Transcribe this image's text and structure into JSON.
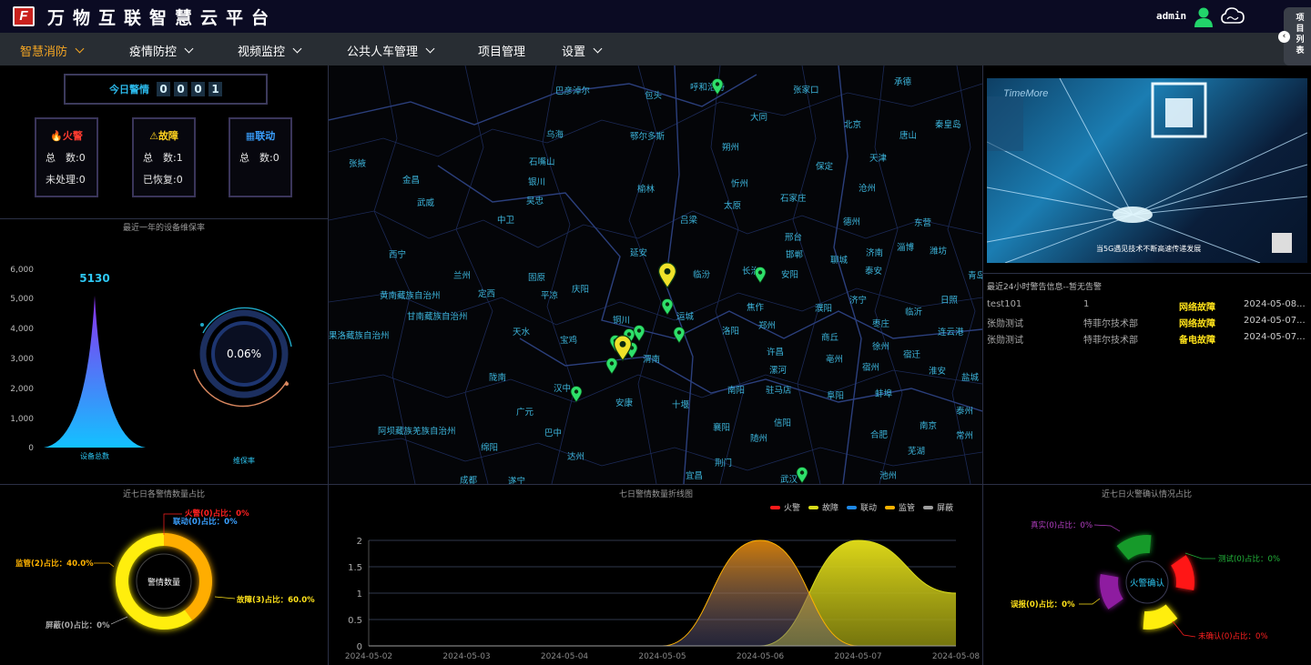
{
  "header": {
    "title": "万物互联智慧云平台",
    "logo_text": "F",
    "user": "admin",
    "user_icon": "person-icon",
    "cloud_icon": "cloud-icon"
  },
  "nav": {
    "items": [
      {
        "label": "智慧消防",
        "has_dropdown": true,
        "active": true
      },
      {
        "label": "疫情防控",
        "has_dropdown": true
      },
      {
        "label": "视频监控",
        "has_dropdown": true
      },
      {
        "label": "公共人车管理",
        "has_dropdown": true
      },
      {
        "label": "项目管理",
        "has_dropdown": false
      },
      {
        "label": "设置",
        "has_dropdown": true
      }
    ],
    "side_tab": "项目列表",
    "accent": "#f5a623"
  },
  "today": {
    "label": "今日警情",
    "digits": [
      "0",
      "0",
      "0",
      "1"
    ]
  },
  "cards": [
    {
      "title": "火警",
      "icon": "flame-icon",
      "color": "#ff3b30",
      "lines": [
        "总　数:0",
        "未处理:0"
      ]
    },
    {
      "title": "故障",
      "icon": "warning-icon",
      "color": "#ffd21f",
      "lines": [
        "总　数:1",
        "已恢复:0"
      ]
    },
    {
      "title": "联动",
      "icon": "link-panel-icon",
      "color": "#3aa0ff",
      "lines": [
        "总　数:0"
      ]
    }
  ],
  "maintenance": {
    "title": "最近一年的设备维保率",
    "peak_label": "5130",
    "y_ticks": [
      "6,000",
      "5,000",
      "4,000",
      "3,000",
      "2,000",
      "1,000",
      "0"
    ],
    "x_label": "设备总数",
    "gauge_value": "0.06%",
    "gauge_label": "维保率"
  },
  "map": {
    "cities": [
      [
        "巴彦淖尔",
        610,
        98
      ],
      [
        "包头",
        708,
        103
      ],
      [
        "呼和浩特",
        758,
        94
      ],
      [
        "张家口",
        871,
        97
      ],
      [
        "承德",
        982,
        88
      ],
      [
        "大同",
        824,
        127
      ],
      [
        "北京",
        927,
        135
      ],
      [
        "秦皇岛",
        1027,
        135
      ],
      [
        "乌海",
        600,
        146
      ],
      [
        "鄂尔多斯",
        692,
        148
      ],
      [
        "朔州",
        793,
        160
      ],
      [
        "唐山",
        988,
        147
      ],
      [
        "天津",
        955,
        172
      ],
      [
        "张掖",
        383,
        178
      ],
      [
        "石嘴山",
        581,
        176
      ],
      [
        "保定",
        896,
        181
      ],
      [
        "金昌",
        442,
        196
      ],
      [
        "银川",
        580,
        198
      ],
      [
        "忻州",
        803,
        200
      ],
      [
        "榆林",
        700,
        206
      ],
      [
        "沧州",
        943,
        205
      ],
      [
        "武威",
        458,
        221
      ],
      [
        "吴忠",
        578,
        219
      ],
      [
        "太原",
        795,
        224
      ],
      [
        "石家庄",
        857,
        216
      ],
      [
        "中卫",
        546,
        240
      ],
      [
        "吕梁",
        747,
        240
      ],
      [
        "德州",
        926,
        242
      ],
      [
        "东营",
        1004,
        243
      ],
      [
        "邢台",
        862,
        259
      ],
      [
        "西宁",
        427,
        278
      ],
      [
        "延安",
        692,
        276
      ],
      [
        "邯郸",
        863,
        278
      ],
      [
        "济南",
        951,
        276
      ],
      [
        "淄博",
        985,
        270
      ],
      [
        "潍坊",
        1021,
        274
      ],
      [
        "兰州",
        498,
        301
      ],
      [
        "固原",
        580,
        303
      ],
      [
        "临汾",
        761,
        300
      ],
      [
        "长治",
        815,
        296
      ],
      [
        "安阳",
        858,
        300
      ],
      [
        "聊城",
        912,
        284
      ],
      [
        "泰安",
        950,
        296
      ],
      [
        "青岛",
        1063,
        301
      ],
      [
        "黄南藏族自治州",
        417,
        323
      ],
      [
        "定西",
        525,
        321
      ],
      [
        "庆阳",
        628,
        316
      ],
      [
        "平凉",
        594,
        323
      ],
      [
        "焦作",
        820,
        336
      ],
      [
        "濮阳",
        895,
        337
      ],
      [
        "济宁",
        933,
        328
      ],
      [
        "日照",
        1033,
        328
      ],
      [
        "甘南藏族自治州",
        447,
        346
      ],
      [
        "铜川",
        673,
        350
      ],
      [
        "运城",
        743,
        346
      ],
      [
        "郑州",
        833,
        356
      ],
      [
        "枣庄",
        958,
        354
      ],
      [
        "临沂",
        994,
        341
      ],
      [
        "果洛藏族自治州",
        361,
        367
      ],
      [
        "天水",
        563,
        363
      ],
      [
        "宝鸡",
        615,
        372
      ],
      [
        "洛阳",
        793,
        362
      ],
      [
        "商丘",
        902,
        369
      ],
      [
        "徐州",
        958,
        379
      ],
      [
        "连云港",
        1030,
        363
      ],
      [
        "渭南",
        706,
        393
      ],
      [
        "许昌",
        842,
        385
      ],
      [
        "亳州",
        907,
        393
      ],
      [
        "宿迁",
        992,
        388
      ],
      [
        "陇南",
        537,
        413
      ],
      [
        "汉中",
        608,
        425
      ],
      [
        "漯河",
        845,
        405
      ],
      [
        "宿州",
        947,
        402
      ],
      [
        "淮安",
        1020,
        406
      ],
      [
        "盐城",
        1056,
        413
      ],
      [
        "安康",
        676,
        441
      ],
      [
        "十堰",
        738,
        443
      ],
      [
        "南阳",
        799,
        427
      ],
      [
        "驻马店",
        841,
        427
      ],
      [
        "阜阳",
        908,
        433
      ],
      [
        "蚌埠",
        961,
        431
      ],
      [
        "广元",
        567,
        451
      ],
      [
        "泰州",
        1050,
        450
      ],
      [
        "阿坝藏族羌族自治州",
        415,
        472
      ],
      [
        "巴中",
        598,
        474
      ],
      [
        "襄阳",
        783,
        468
      ],
      [
        "信阳",
        850,
        463
      ],
      [
        "合肥",
        956,
        476
      ],
      [
        "南京",
        1010,
        466
      ],
      [
        "常州",
        1050,
        477
      ],
      [
        "绵阳",
        528,
        490
      ],
      [
        "达州",
        623,
        500
      ],
      [
        "随州",
        824,
        480
      ],
      [
        "芜湖",
        997,
        494
      ],
      [
        "荆门",
        785,
        507
      ],
      [
        "成都",
        505,
        526
      ],
      [
        "遂宁",
        558,
        527
      ],
      [
        "宜昌",
        753,
        521
      ],
      [
        "武汉",
        857,
        525
      ],
      [
        "池州",
        966,
        521
      ]
    ]
  },
  "video": {
    "caption": "当5G遇见技术不断高速传递发展",
    "logo_text": "TimeMore"
  },
  "alerts": {
    "title": "最近24小时警告信息--暂无告警",
    "rows": [
      {
        "name": "test101",
        "org": "1",
        "type": "网络故障",
        "time": "2024-05-08..."
      },
      {
        "name": "张勋测试",
        "org": "特菲尔技术部",
        "type": "网络故障",
        "time": "2024-05-07..."
      },
      {
        "name": "张勋测试",
        "org": "特菲尔技术部",
        "type": "备电故障",
        "time": "2024-05-07..."
      }
    ]
  },
  "donut": {
    "title": "近七日各警情数量占比",
    "center": "警情数量",
    "labels": [
      "火警(0)占比：0%",
      "联动(0)占比：0%",
      "监管(2)占比：40.0%",
      "故障(3)占比：60.0%",
      "屏蔽(0)占比：0%"
    ]
  },
  "line_chart": {
    "title": "七日警情数量折线图",
    "legend": [
      "火警",
      "故障",
      "联动",
      "监管",
      "屏蔽"
    ],
    "legend_colors": [
      "#ff1a1a",
      "#d9dc1a",
      "#1e88e5",
      "#ffb300",
      "#9e9e9e"
    ]
  },
  "chart_data": [
    {
      "type": "pie",
      "title": "近七日各警情数量占比",
      "categories": [
        "火警",
        "联动",
        "监管",
        "故障",
        "屏蔽"
      ],
      "values": [
        0,
        0,
        2,
        3,
        0
      ],
      "percent": [
        0,
        0,
        40.0,
        60.0,
        0
      ]
    },
    {
      "type": "area",
      "title": "七日警情数量折线图",
      "x": [
        "2024-05-02",
        "2024-05-03",
        "2024-05-04",
        "2024-05-05",
        "2024-05-06",
        "2024-05-07",
        "2024-05-08"
      ],
      "y_ticks": [
        "0",
        "0.5",
        "1",
        "1.5",
        "2"
      ],
      "ylim": [
        0,
        2
      ],
      "series": [
        {
          "name": "火警",
          "values": [
            0,
            0,
            0,
            0,
            0,
            0,
            0
          ]
        },
        {
          "name": "故障",
          "values": [
            0,
            0,
            0,
            0,
            0,
            2,
            1
          ]
        },
        {
          "name": "联动",
          "values": [
            0,
            0,
            0,
            0,
            0,
            0,
            0
          ]
        },
        {
          "name": "监管",
          "values": [
            0,
            0,
            0,
            0,
            2,
            0,
            0
          ]
        },
        {
          "name": "屏蔽",
          "values": [
            0,
            0,
            0,
            0,
            0,
            0,
            0
          ]
        }
      ]
    },
    {
      "type": "pie",
      "title": "近七日火警确认情况占比",
      "categories": [
        "真实",
        "测试",
        "误报",
        "未确认"
      ],
      "values": [
        0,
        0,
        0,
        0
      ]
    }
  ],
  "fire_confirm": {
    "title": "近七日火警确认情况占比",
    "center": "火警确认",
    "labels": [
      "真实(0)占比：0%",
      "测试(0)占比：0%",
      "误报(0)占比：0%",
      "未确认(0)占比：0%"
    ]
  }
}
